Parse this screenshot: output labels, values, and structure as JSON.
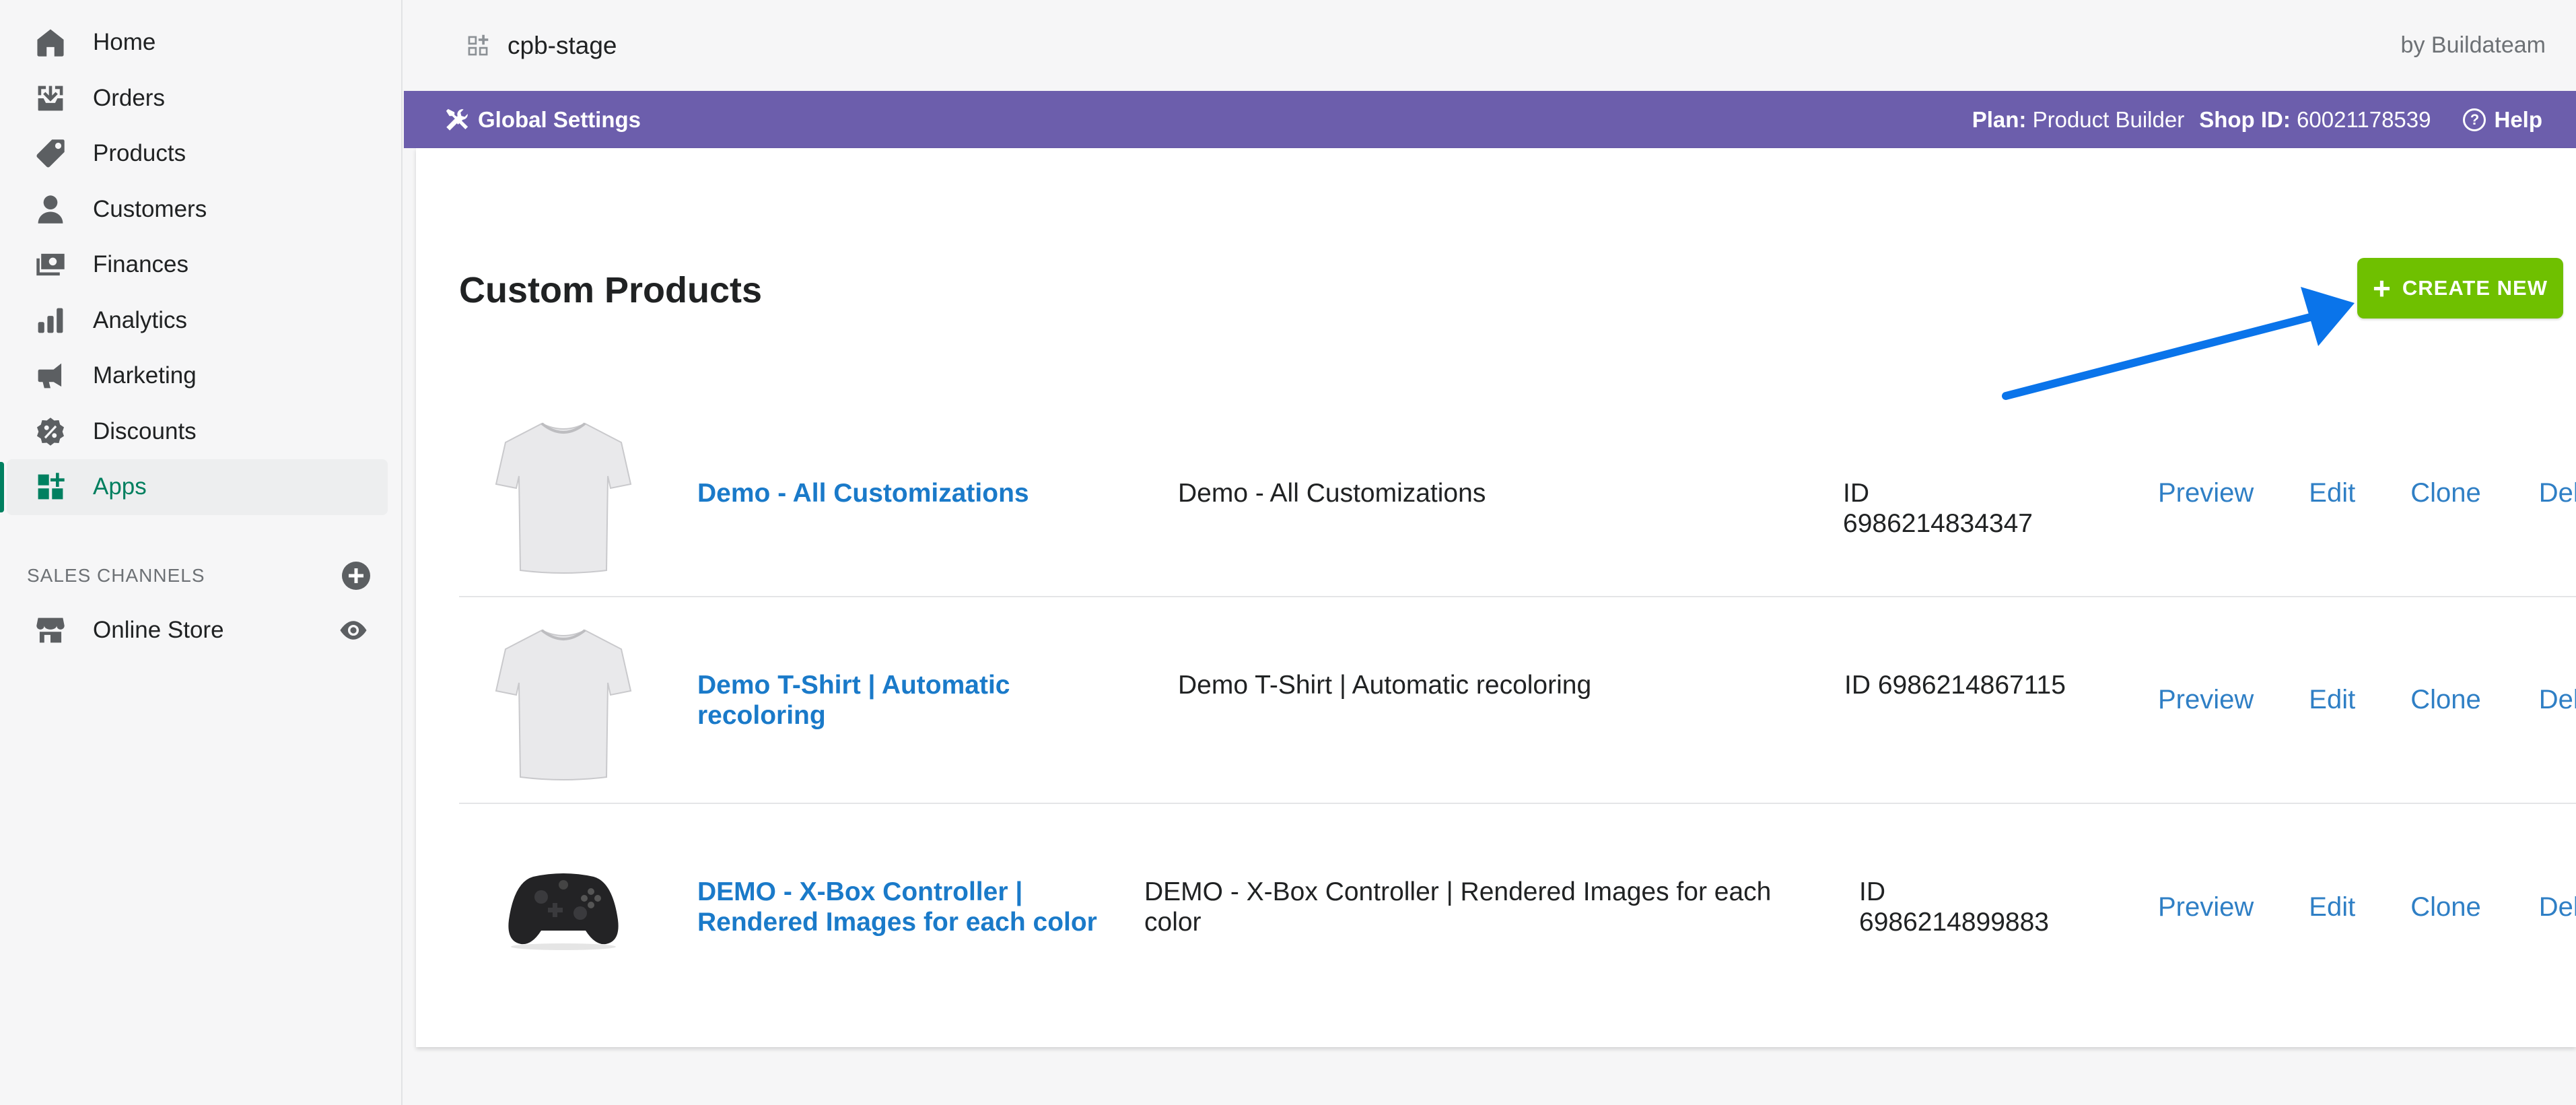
{
  "sidebar": {
    "items": [
      {
        "label": "Home",
        "icon": "home-icon"
      },
      {
        "label": "Orders",
        "icon": "orders-icon"
      },
      {
        "label": "Products",
        "icon": "tag-icon"
      },
      {
        "label": "Customers",
        "icon": "person-icon"
      },
      {
        "label": "Finances",
        "icon": "finances-icon"
      },
      {
        "label": "Analytics",
        "icon": "bar-chart-icon"
      },
      {
        "label": "Marketing",
        "icon": "megaphone-icon"
      },
      {
        "label": "Discounts",
        "icon": "discount-icon"
      },
      {
        "label": "Apps",
        "icon": "apps-icon",
        "active": true
      }
    ],
    "sales_channels_label": "SALES CHANNELS",
    "online_store_label": "Online Store"
  },
  "topbar": {
    "store_name": "cpb-stage",
    "byline": "by Buildateam"
  },
  "purplebar": {
    "global_settings": "Global Settings",
    "plan_label": "Plan:",
    "plan_value": "Product Builder",
    "shop_id_label": "Shop ID:",
    "shop_id_value": "60021178539",
    "help": "Help"
  },
  "main": {
    "title": "Custom Products",
    "create_button": "CREATE NEW",
    "actions": {
      "preview": "Preview",
      "edit": "Edit",
      "clone": "Clone",
      "delete": "Delete"
    },
    "products": [
      {
        "name": "Demo - All Customizations",
        "description": "Demo - All Customizations",
        "id": "ID 6986214834347",
        "thumb": "tshirt"
      },
      {
        "name": "Demo T-Shirt | Automatic recoloring",
        "description": "Demo T-Shirt | Automatic recoloring",
        "id": "ID 6986214867115",
        "thumb": "tshirt"
      },
      {
        "name": "DEMO - X-Box Controller | Rendered Images for each color",
        "description": "DEMO - X-Box Controller | Rendered Images for each color",
        "id": "ID 6986214899883",
        "thumb": "controller"
      }
    ]
  },
  "colors": {
    "purple": "#6c5eac",
    "green": "#6fc000",
    "link": "#1a7ac9",
    "active_nav": "#008060"
  }
}
